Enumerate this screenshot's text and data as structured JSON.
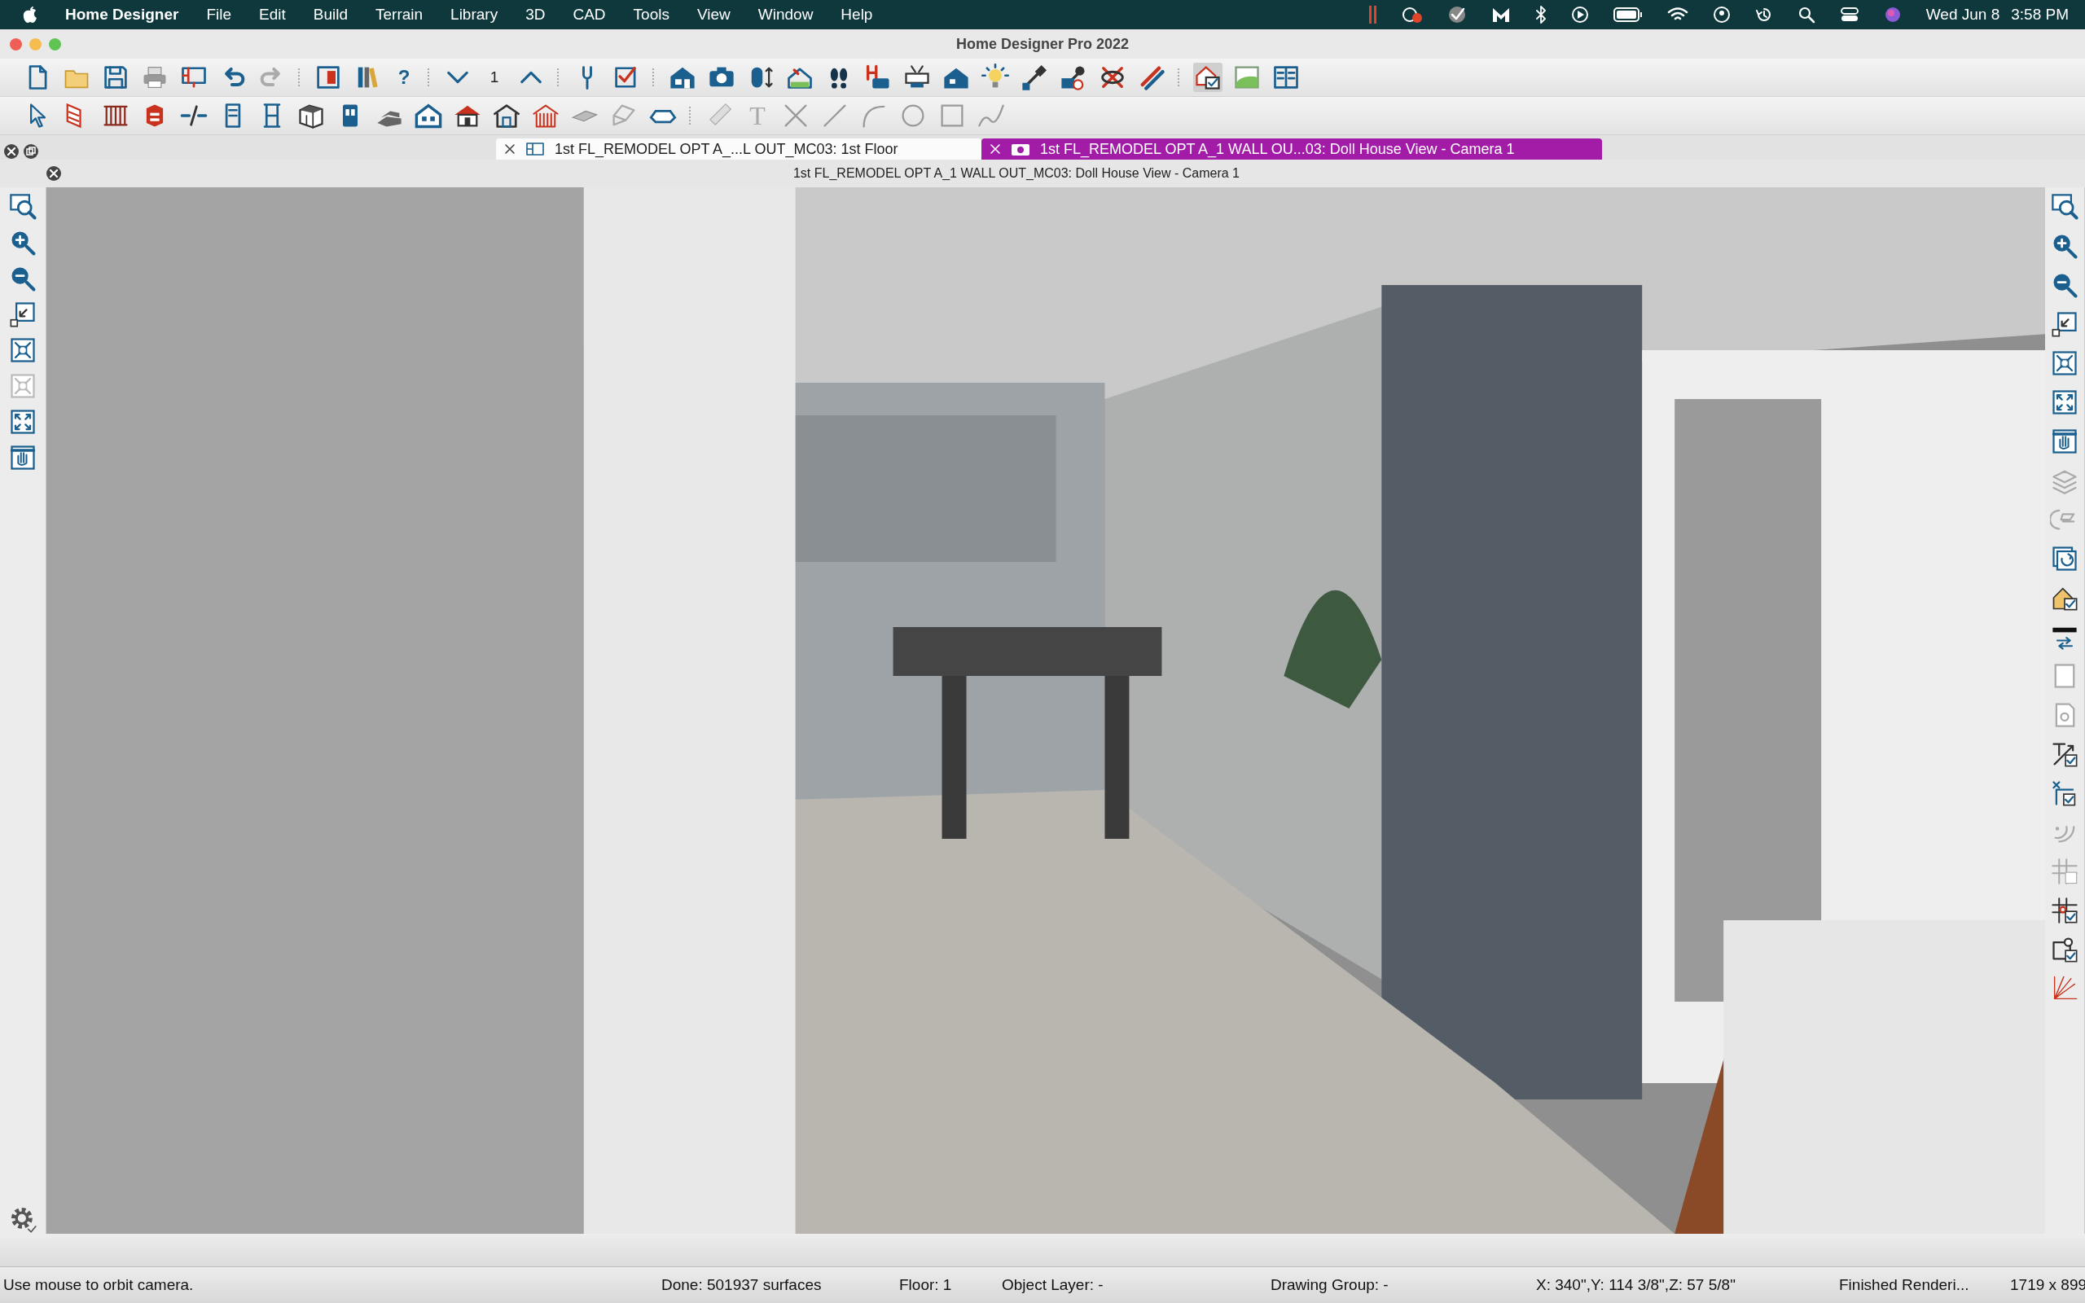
{
  "menu_bar": {
    "app": "Home Designer",
    "menus": [
      "File",
      "Edit",
      "Build",
      "Terrain",
      "Library",
      "3D",
      "CAD",
      "Tools",
      "View",
      "Window",
      "Help"
    ],
    "date": "Wed Jun 8",
    "time": "3:58 PM"
  },
  "window": {
    "title": "Home Designer Pro 2022"
  },
  "toolbar": {
    "help": "?",
    "floor_number": "1",
    "text_tool": "T"
  },
  "tabs": [
    {
      "label": "1st FL_REMODEL OPT A_...L OUT_MC03: 1st Floor",
      "selected": false,
      "kind": "plan"
    },
    {
      "label": "1st FL_REMODEL OPT A_1 WALL OU...03: Doll House View - Camera 1",
      "selected": true,
      "kind": "camera"
    }
  ],
  "view": {
    "title": "1st FL_REMODEL OPT A_1 WALL OUT_MC03: Doll House View - Camera 1"
  },
  "status_bar": [
    "Use mouse to orbit camera.",
    "Done:  501937 surfaces",
    "Floor: 1",
    "Object Layer: -",
    "Drawing Group: -",
    "X: 340\",Y: 114 3/8\",Z: 57 5/8\"",
    "Finished Renderi...",
    "1719 x 899"
  ]
}
